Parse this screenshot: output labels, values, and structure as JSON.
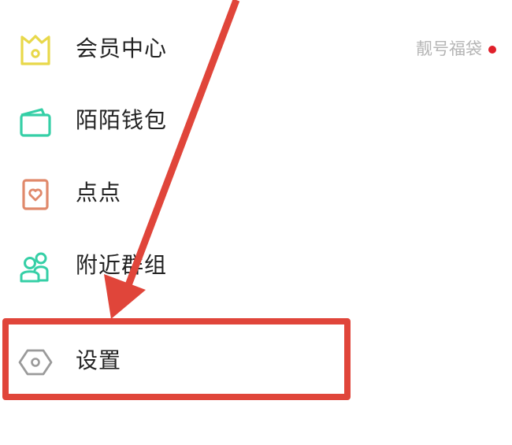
{
  "menu": {
    "items": [
      {
        "label": "会员中心",
        "icon": "crown-icon",
        "icon_color": "#e8d84a",
        "badge": "靓号福袋"
      },
      {
        "label": "陌陌钱包",
        "icon": "wallet-icon",
        "icon_color": "#35cfa6"
      },
      {
        "label": "点点",
        "icon": "heart-card-icon",
        "icon_color": "#e0896b"
      },
      {
        "label": "附近群组",
        "icon": "group-people-icon",
        "icon_color": "#35cfa6"
      },
      {
        "label": "设置",
        "icon": "settings-hexagon-icon",
        "icon_color": "#9a9a9a"
      }
    ]
  },
  "colors": {
    "badge_dot": "#e0202a",
    "annotation": "#e0453a",
    "text": "#222222",
    "badge_text": "#b5b5b5"
  }
}
